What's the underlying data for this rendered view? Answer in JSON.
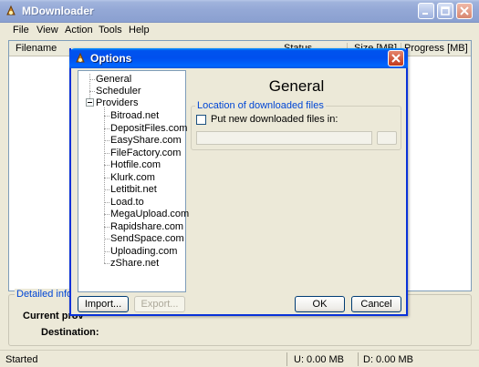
{
  "app": {
    "title": "MDownloader"
  },
  "menu": [
    "File",
    "View",
    "Action",
    "Tools",
    "Help"
  ],
  "columns": {
    "filename": "Filename",
    "status": "Status",
    "size": "Size [MB]",
    "progress": "Progress [MB]"
  },
  "details": {
    "legend": "Detailed informati",
    "current_label": "Current prov",
    "destination_label": "Destination:"
  },
  "status": {
    "state": "Started",
    "upload": "U: 0.00 MB",
    "download": "D: 0.00 MB"
  },
  "dialog": {
    "title": "Options",
    "tree": {
      "general": "General",
      "scheduler": "Scheduler",
      "providers": "Providers",
      "provider_list": [
        "Bitroad.net",
        "DepositFiles.com",
        "EasyShare.com",
        "FileFactory.com",
        "Hotfile.com",
        "Klurk.com",
        "Letitbit.net",
        "Load.to",
        "MegaUpload.com",
        "Rapidshare.com",
        "SendSpace.com",
        "Uploading.com",
        "zShare.net"
      ]
    },
    "page_heading": "General",
    "location_group": {
      "legend": "Location of downloaded files",
      "checkbox_label": "Put new downloaded files in:",
      "path_value": ""
    },
    "buttons": {
      "import": "Import...",
      "export": "Export...",
      "ok": "OK",
      "cancel": "Cancel"
    }
  }
}
